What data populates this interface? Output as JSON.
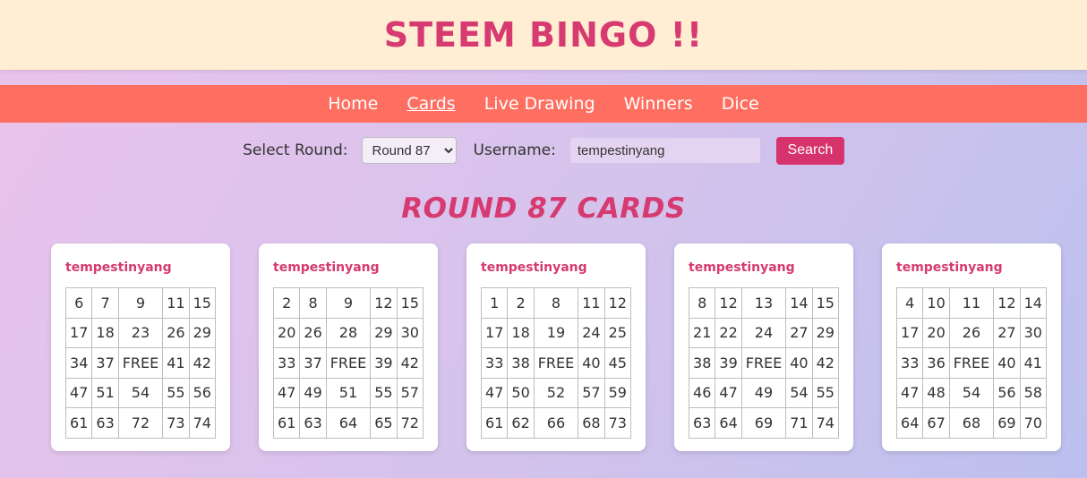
{
  "header": {
    "title": "STEEM BINGO !!"
  },
  "nav": {
    "items": [
      "Home",
      "Cards",
      "Live Drawing",
      "Winners",
      "Dice"
    ],
    "active": "Cards"
  },
  "controls": {
    "round_label": "Select Round:",
    "round_value": "Round 87",
    "username_label": "Username:",
    "username_value": "tempestinyang",
    "search_label": "Search"
  },
  "round_heading": "ROUND 87 CARDS",
  "cards": [
    {
      "user": "tempestinyang",
      "rows": [
        [
          "6",
          "7",
          "9",
          "11",
          "15"
        ],
        [
          "17",
          "18",
          "23",
          "26",
          "29"
        ],
        [
          "34",
          "37",
          "FREE",
          "41",
          "42"
        ],
        [
          "47",
          "51",
          "54",
          "55",
          "56"
        ],
        [
          "61",
          "63",
          "72",
          "73",
          "74"
        ]
      ]
    },
    {
      "user": "tempestinyang",
      "rows": [
        [
          "2",
          "8",
          "9",
          "12",
          "15"
        ],
        [
          "20",
          "26",
          "28",
          "29",
          "30"
        ],
        [
          "33",
          "37",
          "FREE",
          "39",
          "42"
        ],
        [
          "47",
          "49",
          "51",
          "55",
          "57"
        ],
        [
          "61",
          "63",
          "64",
          "65",
          "72"
        ]
      ]
    },
    {
      "user": "tempestinyang",
      "rows": [
        [
          "1",
          "2",
          "8",
          "11",
          "12"
        ],
        [
          "17",
          "18",
          "19",
          "24",
          "25"
        ],
        [
          "33",
          "38",
          "FREE",
          "40",
          "45"
        ],
        [
          "47",
          "50",
          "52",
          "57",
          "59"
        ],
        [
          "61",
          "62",
          "66",
          "68",
          "73"
        ]
      ]
    },
    {
      "user": "tempestinyang",
      "rows": [
        [
          "8",
          "12",
          "13",
          "14",
          "15"
        ],
        [
          "21",
          "22",
          "24",
          "27",
          "29"
        ],
        [
          "38",
          "39",
          "FREE",
          "40",
          "42"
        ],
        [
          "46",
          "47",
          "49",
          "54",
          "55"
        ],
        [
          "63",
          "64",
          "69",
          "71",
          "74"
        ]
      ]
    },
    {
      "user": "tempestinyang",
      "rows": [
        [
          "4",
          "10",
          "11",
          "12",
          "14"
        ],
        [
          "17",
          "20",
          "26",
          "27",
          "30"
        ],
        [
          "33",
          "36",
          "FREE",
          "40",
          "41"
        ],
        [
          "47",
          "48",
          "54",
          "56",
          "58"
        ],
        [
          "64",
          "67",
          "68",
          "69",
          "70"
        ]
      ]
    }
  ]
}
